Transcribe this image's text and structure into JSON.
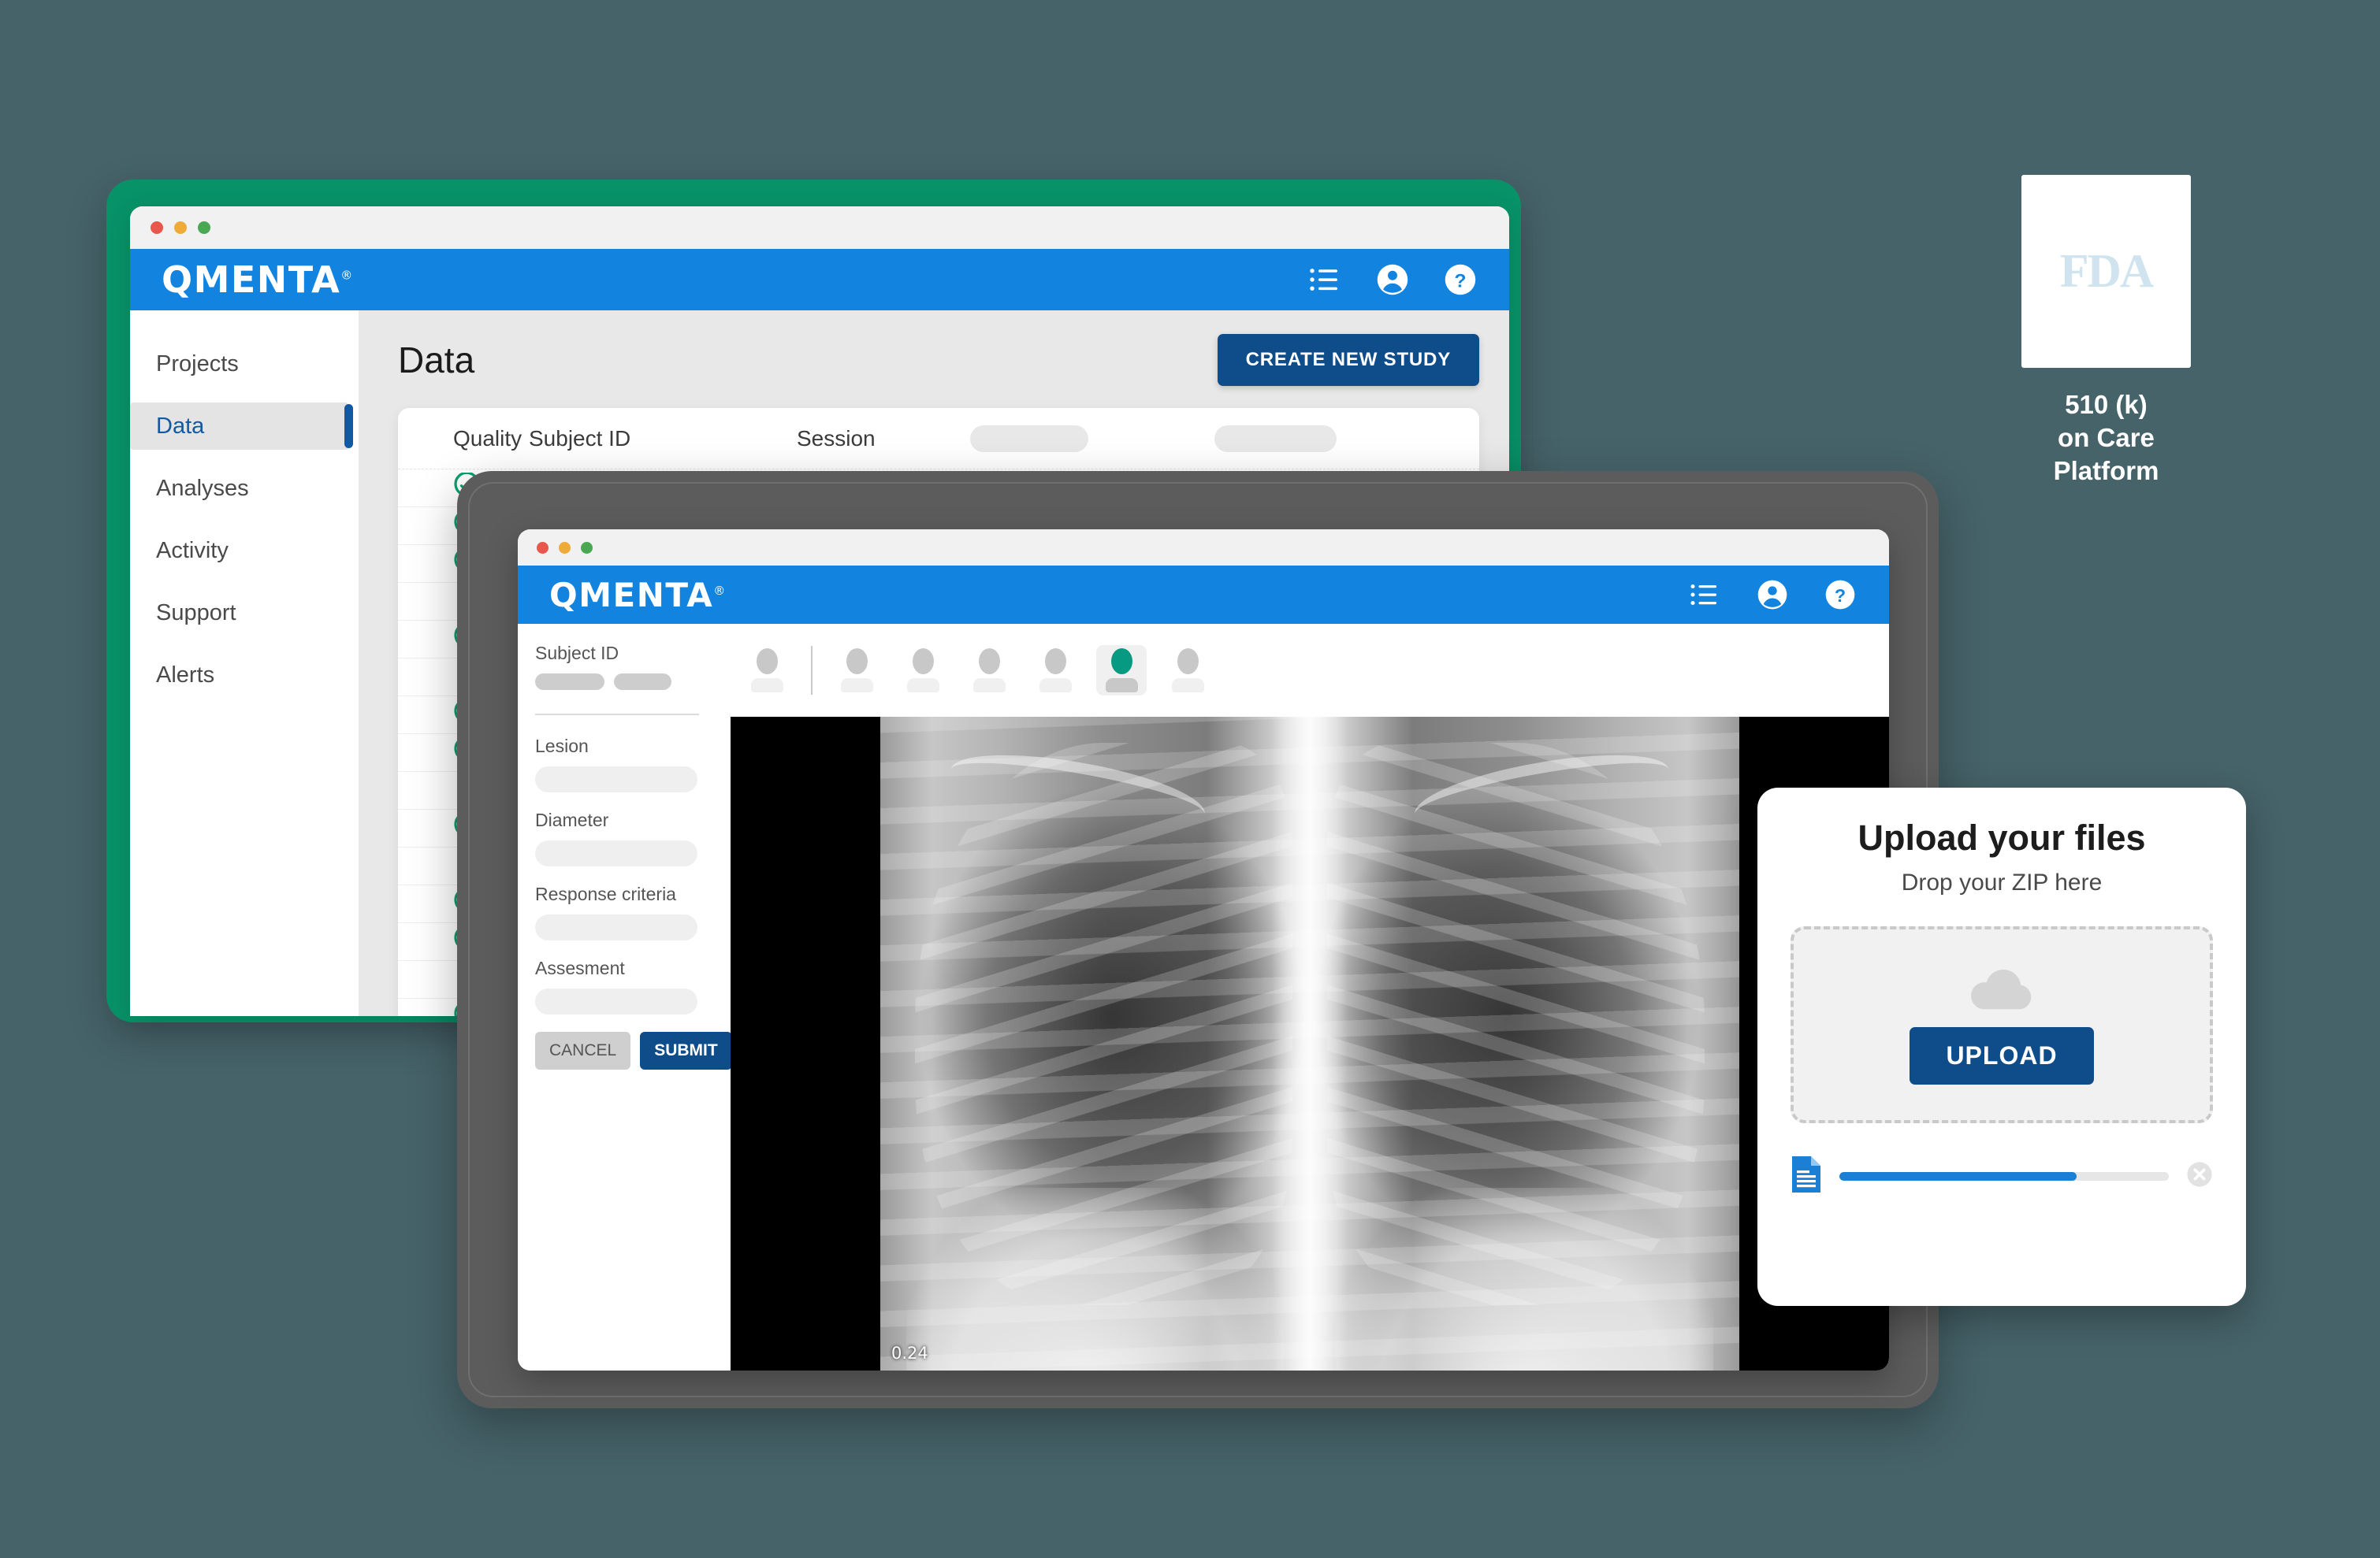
{
  "background": {
    "page_color": "#466369",
    "frame_green": "#089268",
    "tablet_gray": "#5c5c5c"
  },
  "window1": {
    "traffic_lights": [
      "red",
      "yellow",
      "green"
    ],
    "brand": {
      "name": "QMENTA",
      "registered_mark": "®",
      "bar_color": "#1283df"
    },
    "appbar_icons": [
      "list-icon",
      "account-circle-icon",
      "help-circle-icon"
    ],
    "sidebar": {
      "items": [
        {
          "label": "Projects",
          "active": false
        },
        {
          "label": "Data",
          "active": true
        },
        {
          "label": "Analyses",
          "active": false
        },
        {
          "label": "Activity",
          "active": false
        },
        {
          "label": "Support",
          "active": false
        },
        {
          "label": "Alerts",
          "active": false
        }
      ],
      "active_color": "#1259a4"
    },
    "page_title": "Data",
    "create_button": "CREATE NEW STUDY",
    "table": {
      "columns": [
        "",
        "Quality",
        "Subject ID",
        "Session",
        "",
        ""
      ],
      "rows": [
        {
          "quality": "pass"
        },
        {
          "quality": "pass"
        },
        {
          "quality": "pass"
        },
        {
          "quality": "fail"
        },
        {
          "quality": "pass"
        },
        {
          "quality": "fail"
        },
        {
          "quality": "pass"
        },
        {
          "quality": "pass"
        },
        {
          "quality": "fail"
        },
        {
          "quality": "pass"
        },
        {
          "quality": "fail"
        },
        {
          "quality": "pass"
        },
        {
          "quality": "pass"
        },
        {
          "quality": "fail"
        },
        {
          "quality": "pass"
        }
      ],
      "pass_color": "#06a06e",
      "fail_color": "#cc1f33"
    }
  },
  "window2": {
    "traffic_lights": [
      "red",
      "yellow",
      "green"
    ],
    "brand": {
      "name": "QMENTA",
      "registered_mark": "®"
    },
    "appbar_icons": [
      "list-icon",
      "account-circle-icon",
      "help-circle-icon"
    ],
    "form": {
      "subject_id_label": "Subject ID",
      "fields": [
        {
          "label": "Lesion"
        },
        {
          "label": "Diameter"
        },
        {
          "label": "Response criteria"
        },
        {
          "label": "Assesment"
        }
      ],
      "cancel_label": "CANCEL",
      "submit_label": "SUBMIT"
    },
    "thumbnails": {
      "count": 7,
      "active_index": 5,
      "active_color": "#069a82"
    },
    "viewer": {
      "image_type": "chest-xray",
      "overlay_value": "0.24"
    }
  },
  "upload_card": {
    "title": "Upload your files",
    "subtitle": "Drop your ZIP here",
    "dropzone_icon": "cloud-upload-icon",
    "upload_button": "UPLOAD",
    "file_icon": "document-icon",
    "progress_percent": 72,
    "progress_color": "#1b7fd6",
    "remove_icon": "close-icon"
  },
  "fda_badge": {
    "logo_text": "FDA",
    "caption_line1": "510 (k)",
    "caption_line2": "on Care",
    "caption_line3": "Platform"
  }
}
